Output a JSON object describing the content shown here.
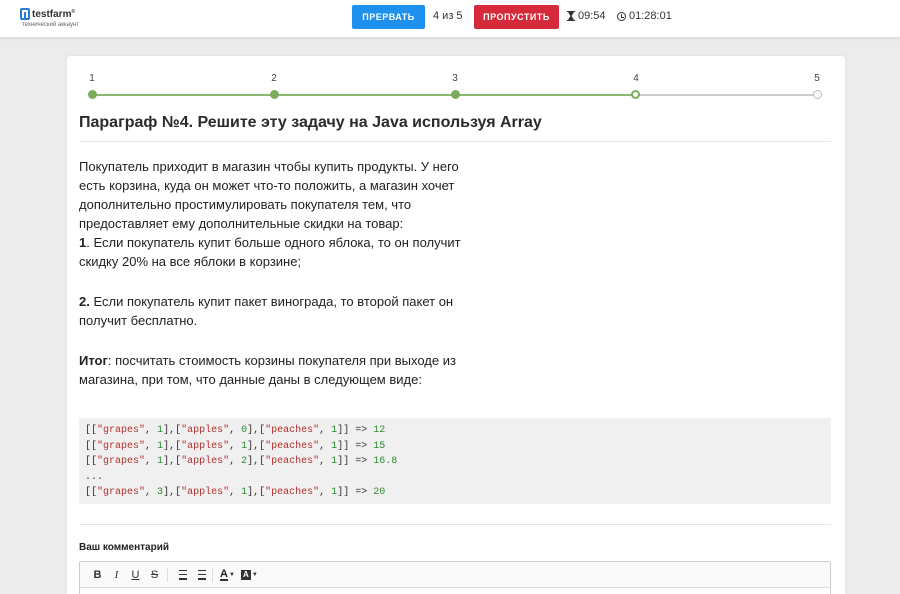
{
  "header": {
    "brand": "testfarm",
    "brand_sup": "®",
    "brand_sub": "технический аккаунт",
    "stop_label": "ПРЕРВАТЬ",
    "progress": "4 из 5",
    "skip_label": "ПРОПУСТИТЬ",
    "question_timer": "09:54",
    "total_timer": "01:28:01"
  },
  "steps": [
    {
      "label": "1",
      "state": "done"
    },
    {
      "label": "2",
      "state": "done"
    },
    {
      "label": "3",
      "state": "done"
    },
    {
      "label": "4",
      "state": "current"
    },
    {
      "label": "5",
      "state": "todo"
    }
  ],
  "question": {
    "title": "Параграф №4. Решите эту задачу на Java используя Array",
    "intro": "Покупатель приходит в магазин чтобы купить продукты. У него есть корзина, куда он может что-то положить, а магазин хочет дополнительно простимулировать покупателя тем, что предоставляет ему дополнительные скидки на товар:",
    "rule1_num": "1",
    "rule1_text": ". Если покупатель купит больше одного яблока, то он получит скидку 20% на все яблоки в корзине;",
    "rule2_num": "2.",
    "rule2_text": " Если покупатель купит пакет винограда, то второй пакет он получит бесплатно.",
    "result_bold": "Итог",
    "result_text": ": посчитать стоимость корзины покупателя при выходе из магазина, при том, что данные даны в следующем виде:"
  },
  "code_lines": [
    {
      "grapes": "1",
      "apples": "0",
      "peaches": "1",
      "result": "12"
    },
    {
      "grapes": "1",
      "apples": "1",
      "peaches": "1",
      "result": "15"
    },
    {
      "grapes": "1",
      "apples": "2",
      "peaches": "1",
      "result": "16.8"
    },
    {
      "ellipsis": "..."
    },
    {
      "grapes": "3",
      "apples": "1",
      "peaches": "1",
      "result": "20"
    }
  ],
  "comment": {
    "label": "Ваш комментарий",
    "toolbar": {
      "bold": "B",
      "italic": "I",
      "underline": "U",
      "strike": "S",
      "color": "A",
      "background": "A"
    }
  }
}
